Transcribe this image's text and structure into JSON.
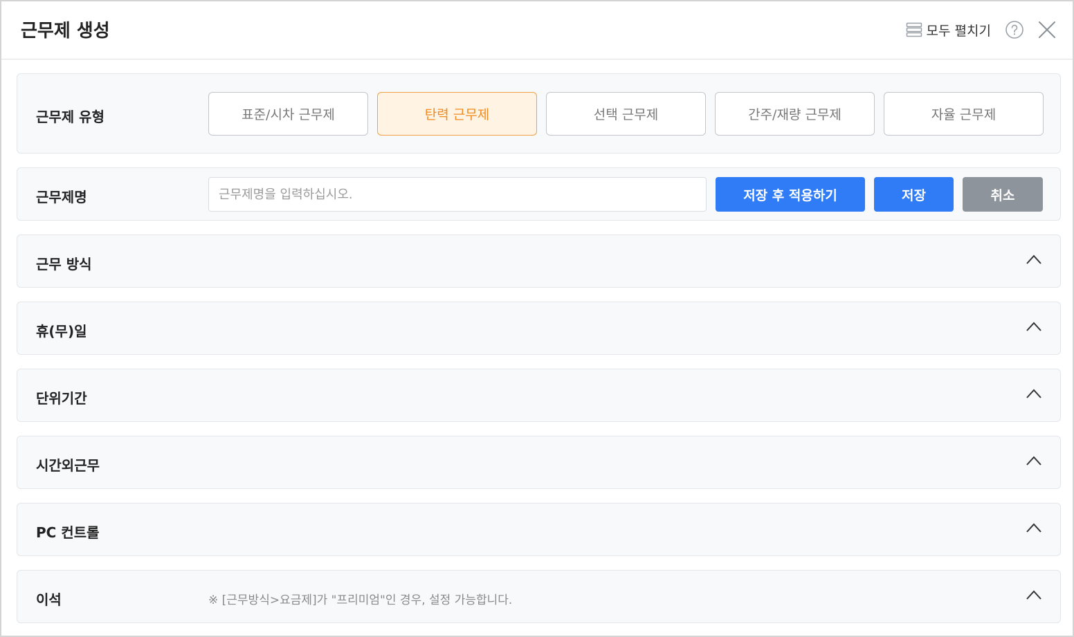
{
  "dialog": {
    "title": "근무제 생성",
    "expand_all_label": "모두 펼치기"
  },
  "work_type": {
    "label": "근무제 유형",
    "options": [
      {
        "label": "표준/시차 근무제",
        "selected": false
      },
      {
        "label": "탄력 근무제",
        "selected": true
      },
      {
        "label": "선택 근무제",
        "selected": false
      },
      {
        "label": "간주/재량 근무제",
        "selected": false
      },
      {
        "label": "자율 근무제",
        "selected": false
      }
    ]
  },
  "work_name": {
    "label": "근무제명",
    "value": "",
    "placeholder": "근무제명을 입력하십시오.",
    "save_apply_label": "저장 후 적용하기",
    "save_label": "저장",
    "cancel_label": "취소"
  },
  "sections": [
    {
      "label": "근무 방식",
      "note": ""
    },
    {
      "label": "휴(무)일",
      "note": ""
    },
    {
      "label": "단위기간",
      "note": ""
    },
    {
      "label": "시간외근무",
      "note": ""
    },
    {
      "label": "PC 컨트롤",
      "note": ""
    },
    {
      "label": "이석",
      "note": "※ [근무방식>요금제]가 \"프리미엄\"인 경우, 설정 가능합니다."
    }
  ],
  "colors": {
    "primary": "#2f7cf6",
    "selected_border": "#f0a046",
    "selected_bg": "#fff3e4",
    "selected_text": "#f08a1d",
    "cancel": "#8e949c"
  },
  "icons": {
    "expand_all": "list-icon",
    "help": "question-circle-icon",
    "close": "close-icon",
    "section_toggle": "chevron-up-icon"
  }
}
